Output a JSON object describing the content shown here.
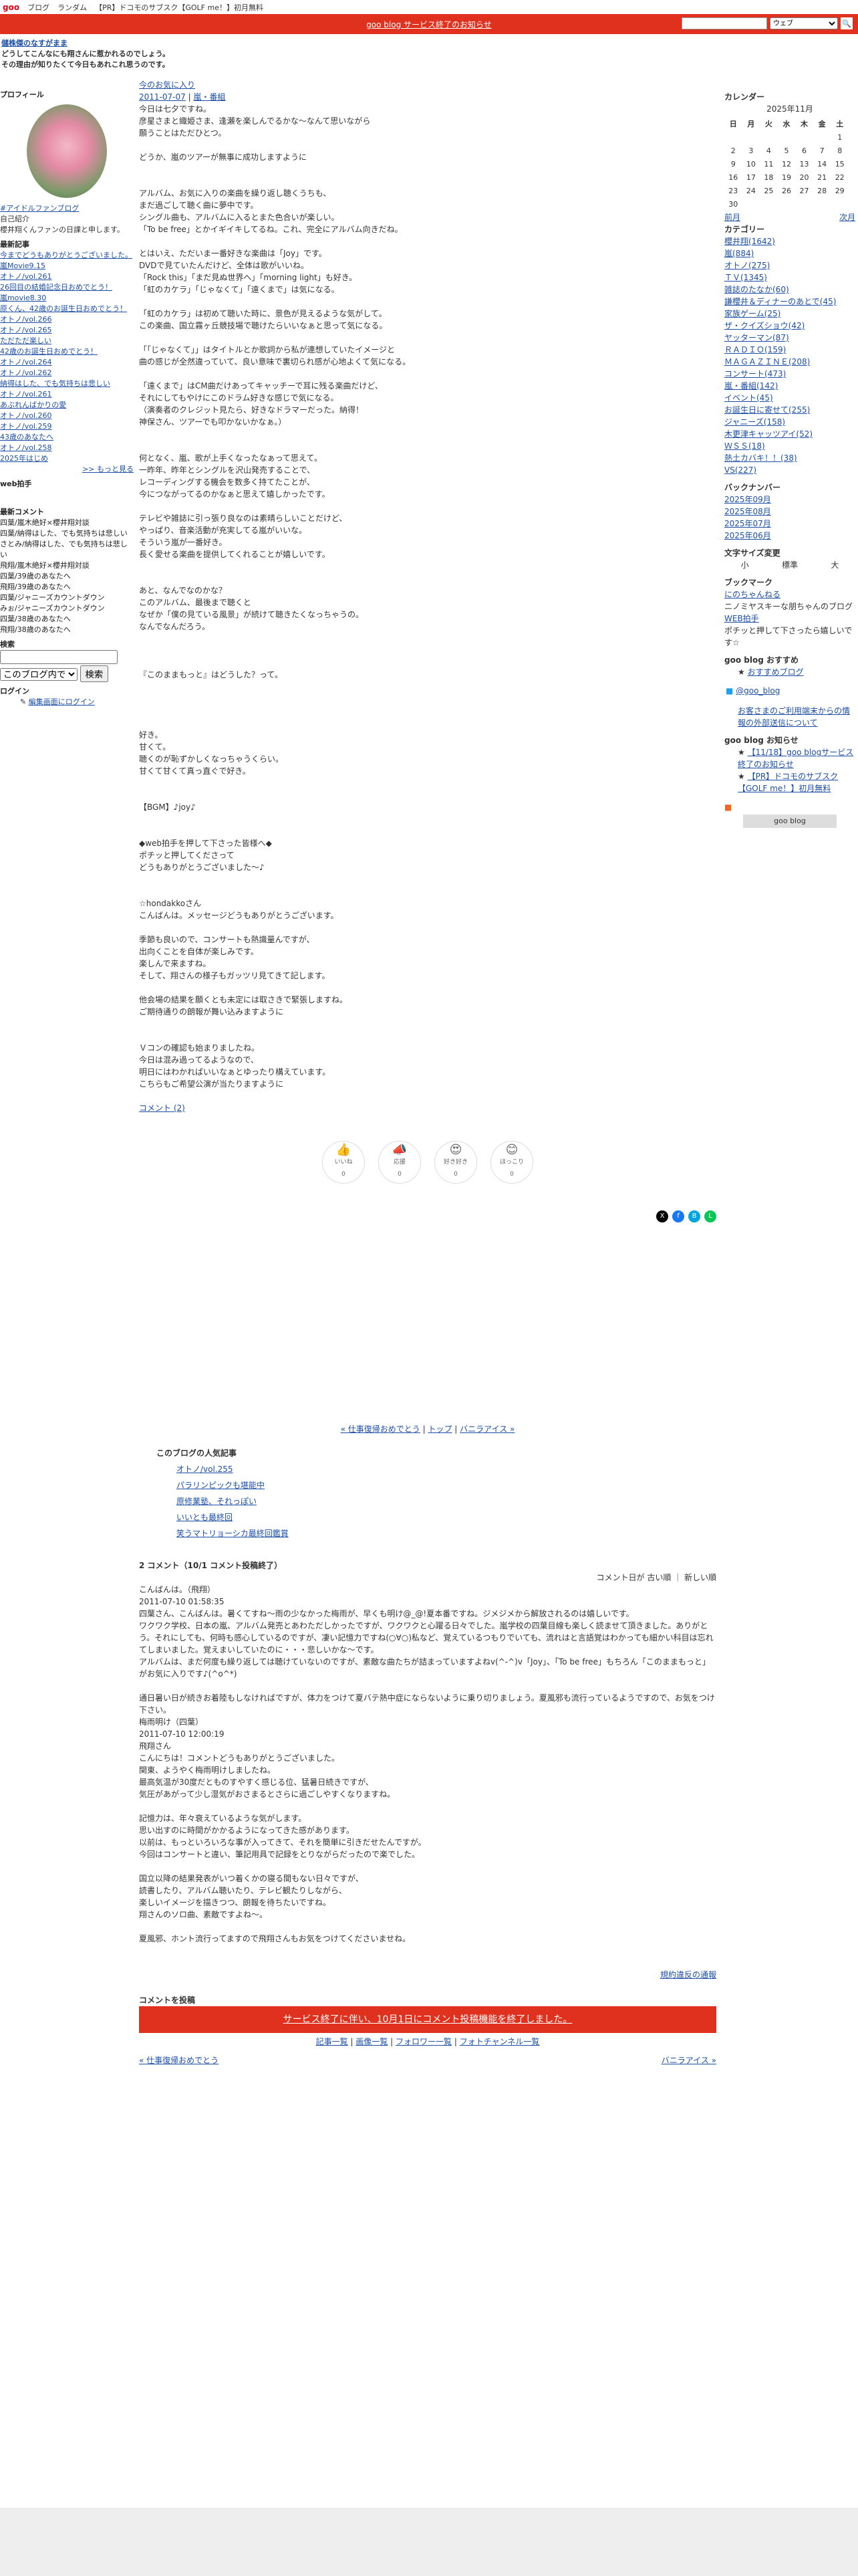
{
  "topbar": {
    "logo": "goo",
    "links": [
      "ブログ",
      "ランダム",
      "【PR】ドコモのサブスク【GOLF me！】初月無料"
    ]
  },
  "redbar": {
    "notice": "goo blog サービス終了のお知らせ",
    "search_placeholder": "",
    "scope": "ウェブ"
  },
  "header": {
    "title": "儲株傑のなすがまま",
    "desc1": "どうしてこんなにも翔さんに惹かれるのでしょう。",
    "desc2": "その理由が知りたくて今日もあれこれ思うのです。"
  },
  "left": {
    "profile_h": "プロフィール",
    "fan_link": "#アイドルファンブログ",
    "intro": "自己紹介",
    "intro_text": "櫻井翔くんファンの日課と申します。",
    "recent_h": "最新記事",
    "recent": [
      "今までどうもありがとうございました。",
      "嵐Movie9.15",
      "オトノ/vol.261",
      "26回目の結婚記念日おめでとう！",
      "嵐movie8.30",
      "原くん、42歳のお誕生日おめでとう！",
      "オトノ/vol.266",
      "オトノ/vol.265",
      "ただただ楽しい",
      "42歳のお誕生日おめでとう！",
      "オトノ/vol.264",
      "オトノ/vol.262",
      "納得はした、でも気持ちは悲しい",
      "オトノ/vol.261",
      "あぶれんばかりの愛",
      "オトノ/vol.260",
      "オトノ/vol.259",
      "43歳のあなたへ",
      "オトノ/vol.258",
      "2025年はじめ"
    ],
    "more": ">> もっと見る",
    "web_h": "web拍手",
    "comments_h": "最新コメント",
    "comments": [
      "四葉/嵐木絶好×櫻井翔対談",
      "四葉/納得はした、でも気持ちは悲しい",
      "さとみ/納得はした、でも気持ちは悲しい",
      "飛翔/嵐木絶好×櫻井翔対談",
      "四葉/39歳のあなたへ",
      "飛翔/39歳のあなたへ",
      "四葉/ジャニーズカウントダウン",
      "みぉ/ジャニーズカウントダウン",
      "四葉/38歳のあなたへ",
      "飛翔/38歳のあなたへ"
    ],
    "search_h": "検索",
    "search_scope": "このブログ内で",
    "search_btn": "検索",
    "login_h": "ログイン",
    "login_link": "編集画面にログイン"
  },
  "post": {
    "title": "今のお気に入り",
    "date": "2011-07-07",
    "category": "嵐・番組",
    "body": "今日は七夕ですね。\n彦星さまと織姫さま、逢瀬を楽しんでるかな〜なんて思いながら\n願うことはただひとつ。\n\nどうか、嵐のツアーが無事に成功しますように\n\n\nアルバム、お気に入りの楽曲を繰り返し聴くうちも、\nまだ過ごして聴く曲に夢中です。\nシングル曲も、アルバムに入るとまた色合いが楽しい。\n「To be free」とかイギイキしてるね。これ、完全にアルバム向きだね。\n\nとはいえ、ただいま一番好きな楽曲は「Joy」です。\nDVDで見ていたんだけど、全体は歌がいいね。\n「Rock this」「まだ見ぬ世界へ」「morning light」も好き。\n「虹のカケラ」「じゃなくて」「遠くまで」は気になる。\n\n「虹のカケラ」は初めて聴いた時に、景色が見えるような気がして。\nこの楽曲、国立霧ヶ丘競技場で聴けたらいいなぁと思って気になる。\n\n「「じゃなくて」」はタイトルとか歌詞から私が連想していたイメージと\n曲の感じが全然違っていて、良い意味で裏切られ感が心地よくて気になる。\n\n「遠くまで」はCM曲だけあってキャッチーで耳に残る楽曲だけど、\nそれにしてもやけにこのドラム好きな感じで気になる。\n（演奏者のクレジット見たら、好きなドラマーだった。納得！\n神保さん、ツアーでも叩かないかなぁ。）\n\n\n何となく、嵐、歌が上手くなったなぁって思えて。\n一昨年、昨年とシングルを沢山発売することで、\nレコーディングする機会を数多く持てたことが、\n今につながってるのかなぁと思えて嬉しかったです。\n\nテレビや雑誌に引っ張り良なのは素晴らしいことだけど、\nやっぱり、音楽活動が充実してる嵐がいいな。\nそういう嵐が一番好き。\n長く愛せる楽曲を提供してくれることが嬉しいです。\n\n\nあと、なんでなのかな？\nこのアルバム、最後まで聴くと\nなぜか「僕の見ている風景」が続けて聴きたくなっちゃうの。\nなんでなんだろう。",
    "body2": "『このままもっと』はどうした？って。",
    "body3": "好き。\n甘くて。\n聴くのが恥ずかしくなっちゃうくらい。\n甘くて甘くて真っ直ぐで好き。\n\n\n【BGM】♪joy♪\n\n\n◆web拍手を押して下さった皆様へ◆\nポチッと押してくださって\nどうもありがとうございました〜♪\n\n\n☆hondakkoさん\nこんばんは。メッセージどうもありがとうございます。\n\n季節も良いので、コンサートも熱識量んですが、\n出向くことを自体が楽しみです。\n楽しんで来ますね。\nそして、翔さんの様子もガッツリ見てきて記します。\n\n他会場の結果を願くとも未定には取さきで緊張しますね。\nご期待通りの朗報が舞い込みますように\n\n\nＶコンの確認も始まりましたね。\n今日は混み過ってるようなので、\n明日にはわかればいいなぁとゆったり構えています。\nこちらもご希望公演が当たりますように",
    "comment_link": "コメント (2)"
  },
  "reactions": [
    {
      "icon": "👍",
      "label": "いいね",
      "count": "0"
    },
    {
      "icon": "📣",
      "label": "応援",
      "count": "0"
    },
    {
      "icon": "😍",
      "label": "好き好き",
      "count": "0"
    },
    {
      "icon": "😊",
      "label": "ほっこり",
      "count": "0"
    }
  ],
  "nav": {
    "prev": "« 仕事復帰おめでとう",
    "top": "トップ",
    "next": "バニラアイス »"
  },
  "popular": {
    "h": "このブログの人気記事",
    "items": [
      "オトノ/vol.255",
      "パラリンピックも堪能中",
      "原修業塾、それっぽい",
      "いいとも最終回",
      "笑うマトリョーシカ最終回鑑賞"
    ]
  },
  "comments": {
    "h": "2 コメント（10/1 コメント投稿終了）",
    "sort": "コメント日が 古い順 ｜ 新しい順",
    "c1_head": "こんばんは。（飛翔）",
    "c1_date": "2011-07-10 01:58:35",
    "c1_body": "四葉さん、こんばんは。暑くてすね〜雨の少なかった梅雨が、早くも明け@_@!夏本番ですね。ジメジメから解放されるのは嬉しいです。\nワクワク学校、日本の嵐、アルバム発売とあわただしかったですが、ワクワクと心躍る日々でした。嵐学校の四葉目線も楽しく読ませて頂きました。ありがとう。それにしても、何時も感心しているのですが、凄い記憶力ですね(○∀○)私など、覚えているつもりでいても、流れはと言語覚はわかっても細かい科目は忘れてしまいました。覚えまいしていたのに・・・悲しいかな〜です。\nアルバムは、まだ何度も繰り返しては聴けていないのですが、素敵な曲たちが詰まっていますよねv(^-^)v「Joy」、「To be free」もちろん「このままもっと」がお気に入りです♪(^o^*)\n\n通日暑い日が続きお着陸もしなければですが、体力をつけて夏バテ熱中症にならないように乗り切りましょう。夏風邪も流行っているようですので、お気をつけ下さい。",
    "c2_head": "梅雨明け（四葉）",
    "c2_date": "2011-07-10 12:00:19",
    "c2_body": "飛翔さん\nこんにちは！コメントどうもありがとうございました。\n関東、ようやく梅雨明けしましたね。\n最高気温が30度だとものすやすく感じる位、猛暑日続きですが、\n気圧があがって少し湿気がおさまるとさらに過ごしやすくなりますね。\n\n記憶力は、年々衰えているような気がします。\n思い出すのに時間がかかるようになってきた感があります。\n以前は、もっといろいろな事が入ってきて、それを簡単に引きだせたんですが。\n今回はコンサートと違い、筆記用具で記録をとりながらだったので楽でした。\n\n国立以降の結果発表がいつ着くかの寝る間もない日々ですが、\n読書したり、アルバム聴いたり、テレビ観たりしながら、\n楽しいイメージを描きつつ、朗報を待ちたいですね。\n翔さんのソロ曲、素敵ですよね〜。\n\n夏風邪、ホント流行ってますので飛翔さんもお気をつけてくださいませね。",
    "report": "規約違反の通報",
    "post_h": "コメントを投稿",
    "post_notice": "サービス終了に伴い、10月1日にコメント投稿機能を終了しました。",
    "links": [
      "記事一覧",
      "画像一覧",
      "フォロワー一覧",
      "フォトチャンネル一覧"
    ],
    "prev2": "« 仕事復帰おめでとう",
    "next2": "バニラアイス »"
  },
  "right": {
    "cal_h": "カレンダー",
    "cal_month": "2025年11月",
    "cal_days": [
      "日",
      "月",
      "火",
      "水",
      "木",
      "金",
      "土"
    ],
    "cal_rows": [
      [
        "",
        "",
        "",
        "",
        "",
        "",
        "1"
      ],
      [
        "2",
        "3",
        "4",
        "5",
        "6",
        "7",
        "8"
      ],
      [
        "9",
        "10",
        "11",
        "12",
        "13",
        "14",
        "15"
      ],
      [
        "16",
        "17",
        "18",
        "19",
        "20",
        "21",
        "22"
      ],
      [
        "23",
        "24",
        "25",
        "26",
        "27",
        "28",
        "29"
      ],
      [
        "30",
        "",
        "",
        "",
        "",
        "",
        ""
      ]
    ],
    "cal_prev": "前月",
    "cal_next": "次月",
    "cat_h": "カテゴリー",
    "cats": [
      "櫻井翔(1642)",
      "嵐(884)",
      "オトノ(275)",
      "ＴＶ(1345)",
      "雑誌のたなか(60)",
      "謙櫻井＆ディナーのあとで(45)",
      "家族ゲーム(25)",
      "ザ・クイズショウ(42)",
      "ヤッターマン(87)",
      "ＲＡＤＩＯ(159)",
      "ＭＡＧＡＺＩＮＥ(208)",
      "コンサート(473)",
      "嵐・番組(142)",
      "イベント(45)",
      "お誕生日に寄せて(255)",
      "ジャニーズ(158)",
      "木更津キャッツアイ(52)",
      "ＷＳＳ(18)",
      "熱土カバキ！！(38)",
      "VS(227)"
    ],
    "bn_h": "バックナンバー",
    "bn": [
      "2025年09月",
      "2025年08月",
      "2025年07月",
      "2025年06月"
    ],
    "font_h": "文字サイズ変更",
    "font_opts": [
      "小",
      "標準",
      "大"
    ],
    "bm_h": "ブックマーク",
    "bm1": "にのちゃんねる",
    "bm1_d": "ニノミヤスキーな朋ちゃんのブログ",
    "bm2": "WEB拍手",
    "bm2_d": "ポチッと押して下さったら嬉しいです☆",
    "rec_h": "goo blog おすすめ",
    "rec": "おすすめブログ",
    "tw": "@goo_blog",
    "notice_link": "お客さまのご利用端末からの情報の外部送信について",
    "news_h": "goo blog お知らせ",
    "news": [
      "【11/18】goo blogサービス終了のお知らせ",
      "【PR】ドコモのサブスク【GOLF me！】初月無料"
    ],
    "banner": "goo blog"
  }
}
